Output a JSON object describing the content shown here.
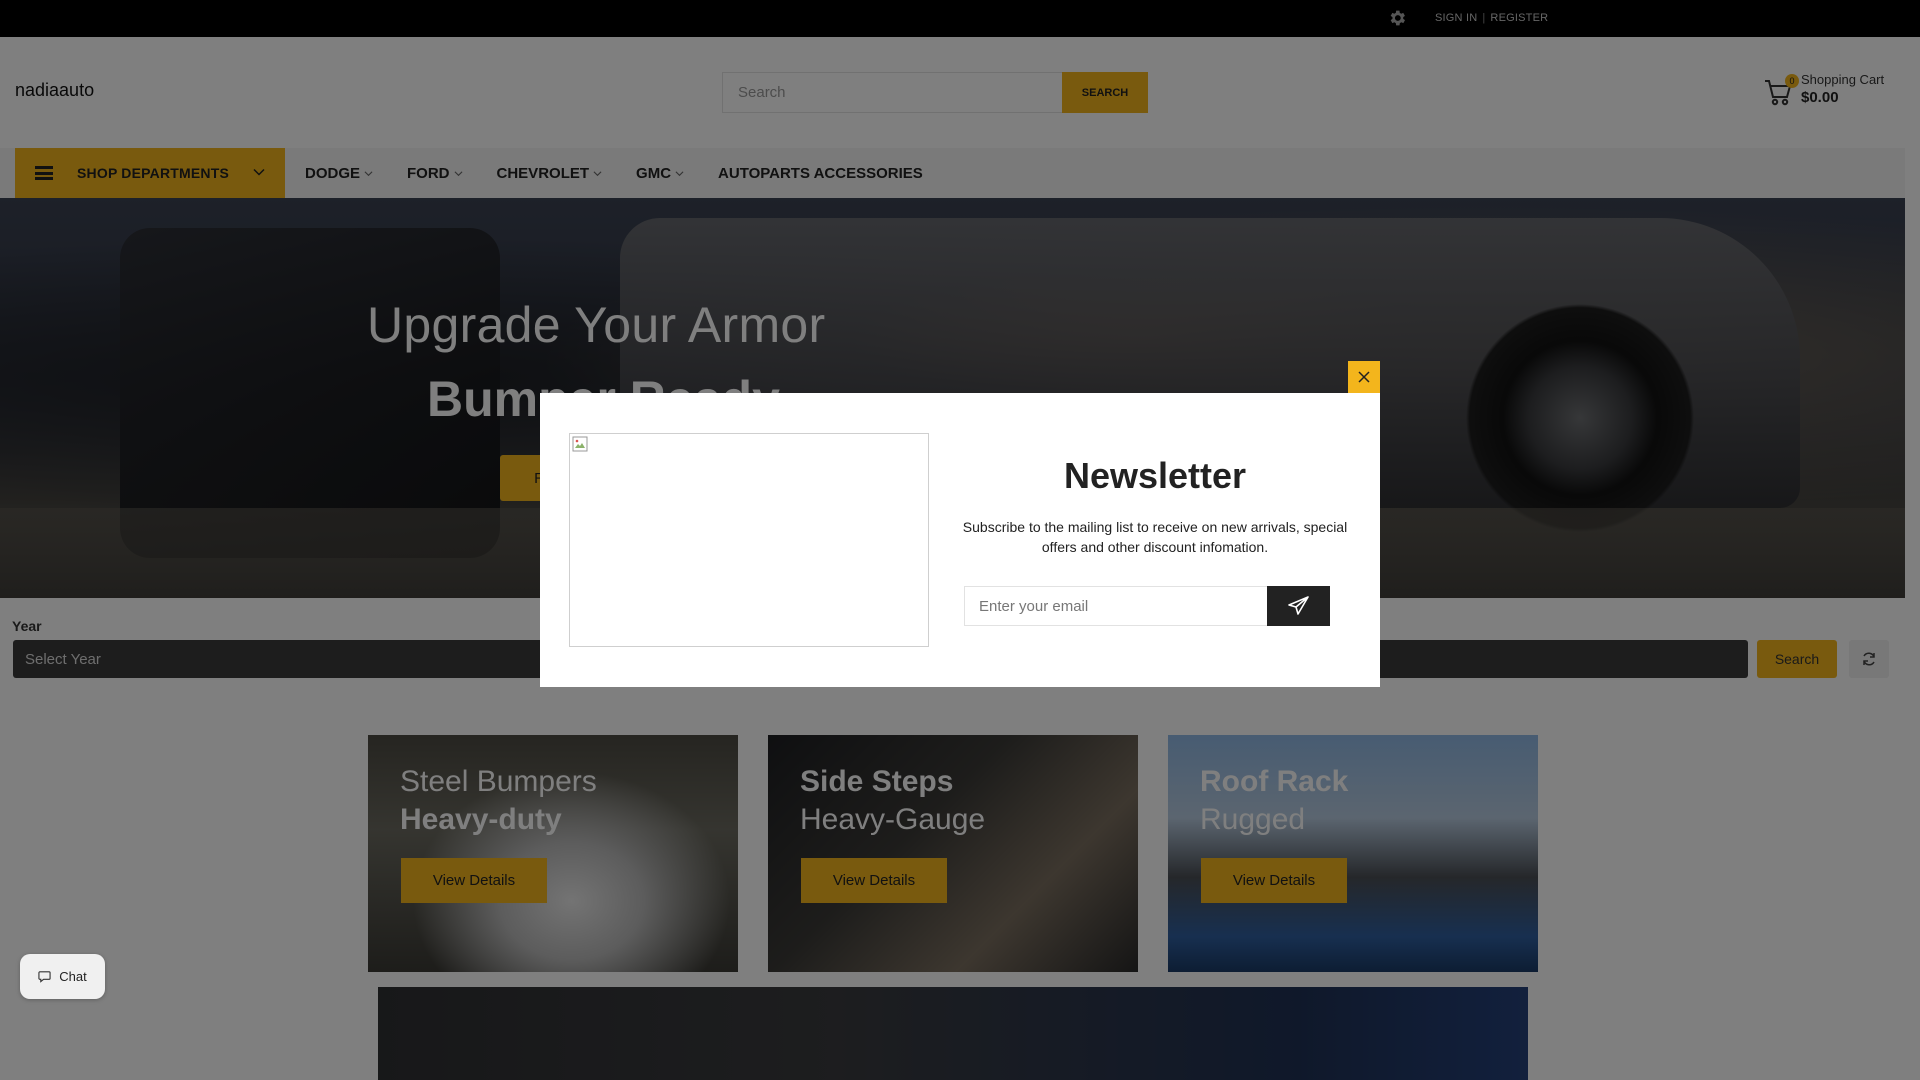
{
  "topbar": {
    "sign_in": "SIGN IN",
    "separator": "|",
    "register": "REGISTER",
    "settings_icon": "gear-icon"
  },
  "header": {
    "logo": "nadiaauto",
    "search": {
      "placeholder": "Search",
      "button": "SEARCH"
    },
    "cart": {
      "badge": "0",
      "label": "Shopping Cart",
      "total": "$0.00",
      "icon": "cart-icon"
    }
  },
  "nav": {
    "departments": "SHOP DEPARTMENTS",
    "links": [
      {
        "label": "DODGE",
        "dropdown": true
      },
      {
        "label": "FORD",
        "dropdown": true
      },
      {
        "label": "CHEVROLET",
        "dropdown": true
      },
      {
        "label": "GMC",
        "dropdown": true
      },
      {
        "label": "AUTOPARTS ACCESSORIES",
        "dropdown": false
      }
    ]
  },
  "hero": {
    "line1": "Upgrade Your Armor",
    "line2": "Bumper Ready",
    "button": "Ready for Adventure"
  },
  "finder": {
    "year_label": "Year",
    "year_placeholder": "Select Year",
    "search": "Search",
    "reset_icon": "refresh-icon"
  },
  "cards": [
    {
      "title": "Steel Bumpers",
      "subtitle": "Heavy-duty",
      "button": "View Details"
    },
    {
      "title": "Side Steps",
      "subtitle": "Heavy-Gauge",
      "button": "View Details"
    },
    {
      "title": "Roof Rack",
      "subtitle": "Rugged",
      "button": "View Details"
    }
  ],
  "chat": {
    "label": "Chat",
    "icon": "chat-bubble-icon"
  },
  "newsletter": {
    "title": "Newsletter",
    "description": "Subscribe to the mailing list to receive on new arrivals, special offers and other discount infomation.",
    "email_placeholder": "Enter your email",
    "send_icon": "paper-plane-icon",
    "close_icon": "close-icon"
  },
  "colors": {
    "accent": "#f3b51c",
    "topbar": "#000000",
    "dark": "#222222"
  }
}
